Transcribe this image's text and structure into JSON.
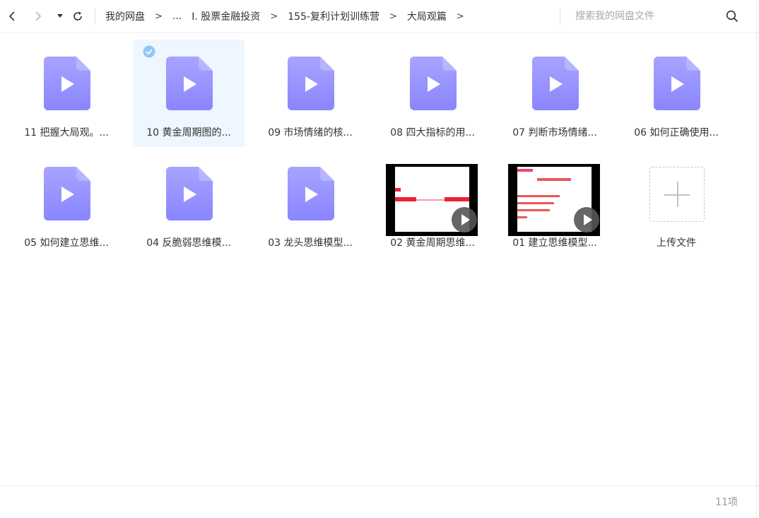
{
  "breadcrumbs": [
    "我的网盘",
    "...",
    "I. 股票金融投资",
    "155-复利计划训练营",
    "大局观篇"
  ],
  "breadcrumb_separator": ">",
  "search": {
    "placeholder": "搜索我的网盘文件"
  },
  "files": [
    {
      "name": "11 把握大局观。...",
      "kind": "video-icon",
      "selected": false
    },
    {
      "name": "10 黄金周期图的...",
      "kind": "video-icon",
      "selected": true
    },
    {
      "name": "09 市场情绪的核...",
      "kind": "video-icon",
      "selected": false
    },
    {
      "name": "08 四大指标的用...",
      "kind": "video-icon",
      "selected": false
    },
    {
      "name": "07 判断市场情绪...",
      "kind": "video-icon",
      "selected": false
    },
    {
      "name": "06 如何正确使用...",
      "kind": "video-icon",
      "selected": false
    },
    {
      "name": "05 如何建立思维...",
      "kind": "video-icon",
      "selected": false
    },
    {
      "name": "04 反脆弱思维模...",
      "kind": "video-icon",
      "selected": false
    },
    {
      "name": "03 龙头思维模型...",
      "kind": "video-icon",
      "selected": false
    },
    {
      "name": "02 黄金周期思维...",
      "kind": "video-thumbnail",
      "selected": false
    },
    {
      "name": "01 建立思维模型...",
      "kind": "video-thumbnail",
      "selected": false
    }
  ],
  "upload_label": "上传文件",
  "item_count": "11项",
  "colors": {
    "file_icon_top": "#a7a4ff",
    "file_icon_bottom": "#8a85ff",
    "selected_bg": "#eef6ff",
    "check": "#8fc8f7"
  }
}
